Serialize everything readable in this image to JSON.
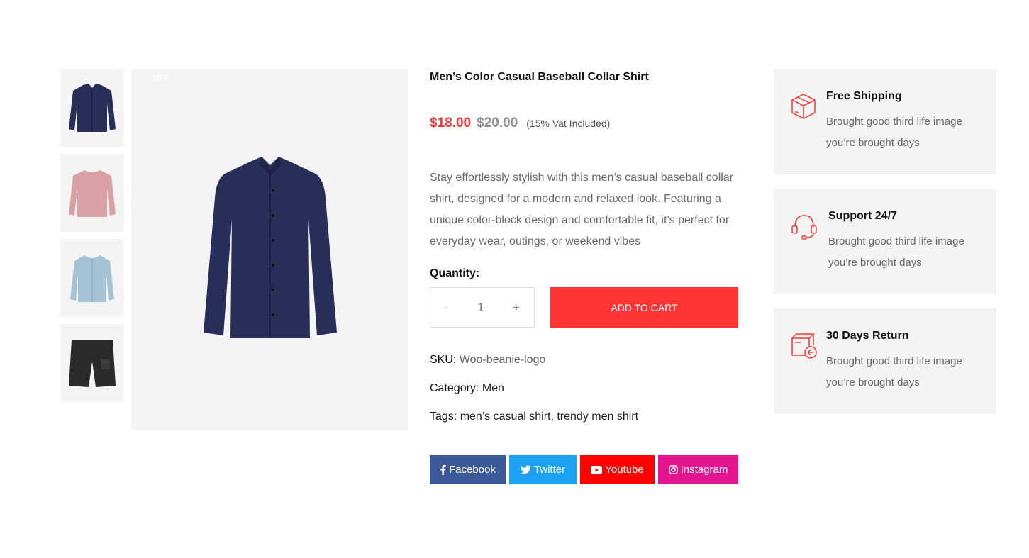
{
  "gallery": {
    "thumbnails": [
      {
        "name": "navy-shirt",
        "color": "#272e58"
      },
      {
        "name": "pink-sweater",
        "color": "#d9a0a6"
      },
      {
        "name": "light-blue-cardigan",
        "color": "#a6c3d6"
      },
      {
        "name": "black-cargo-shorts",
        "color": "#2a2a2a"
      }
    ],
    "badge": "10%",
    "main_color": "#272e58"
  },
  "product": {
    "title": "Men’s Color Casual Baseball Collar Shirt",
    "price_new": "$18.00",
    "price_old": "$20.00",
    "vat_note": "(15% Vat Included)",
    "description": "Stay effortlessly stylish with this men’s casual baseball collar shirt, designed for a modern and relaxed look. Featuring a unique color-block design and comfortable fit, it’s perfect for everyday wear, outings, or weekend vibes",
    "quantity_label": "Quantity:",
    "quantity": {
      "minus": "-",
      "value": "1",
      "plus": "+"
    },
    "add_to_cart": "ADD TO CART",
    "sku_label": "SKU:",
    "sku_value": "Woo-beanie-logo",
    "category_label": "Category:",
    "category_value": "Men",
    "tags_label": "Tags:",
    "tags_value": "men’s casual shirt, trendy men shirt"
  },
  "social": [
    {
      "label": "Facebook",
      "icon": "facebook-icon",
      "color": "#3b5998"
    },
    {
      "label": "Twitter",
      "icon": "twitter-icon",
      "color": "#1da1f2"
    },
    {
      "label": "Youtube",
      "icon": "youtube-icon",
      "color": "#ff0000"
    },
    {
      "label": "Instagram",
      "icon": "instagram-icon",
      "color": "#e4148f"
    }
  ],
  "features": [
    {
      "title": "Free Shipping",
      "text": "Brought good third life image you’re brought days",
      "icon": "box-icon"
    },
    {
      "title": "Support 24/7",
      "text": "Brought good third life image you’re brought days",
      "icon": "headset-icon"
    },
    {
      "title": "30 Days Return",
      "text": "Brought good third life image you’re brought days",
      "icon": "return-box-icon"
    }
  ],
  "colors": {
    "accent": "#ff3434",
    "price": "#f23838",
    "panel": "#f4f4f4"
  }
}
